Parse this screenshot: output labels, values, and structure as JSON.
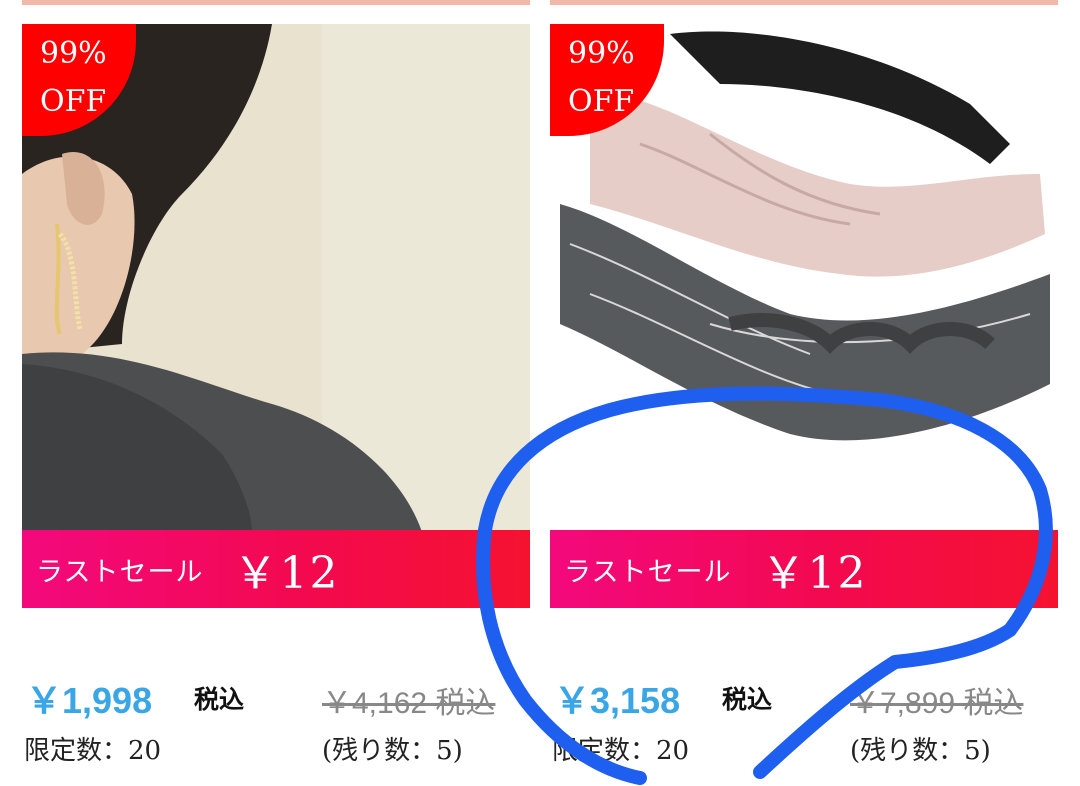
{
  "products": [
    {
      "image": "earring-model-photo",
      "badge": [
        "99%",
        "OFF"
      ],
      "sale_label": "ラストセール",
      "sale_price": "￥12",
      "current_price": "￥1,998",
      "tax_label": "税込",
      "original_price": "￥4,162 税込",
      "limit_qty": "限定数：20",
      "remaining_qty": "(残り数：5)"
    },
    {
      "image": "braided-headbands-photo",
      "badge": [
        "99%",
        "OFF"
      ],
      "sale_label": "ラストセール",
      "sale_price": "￥12",
      "current_price": "￥3,158",
      "tax_label": "税込",
      "original_price": "￥7,899 税込",
      "limit_qty": "限定数：20",
      "remaining_qty": "(残り数：5)"
    }
  ],
  "colors": {
    "badge": "#ff0000",
    "sale_banner": "#f3094f",
    "current_price": "#3aa6e6",
    "annotation": "#1f5ff0"
  }
}
